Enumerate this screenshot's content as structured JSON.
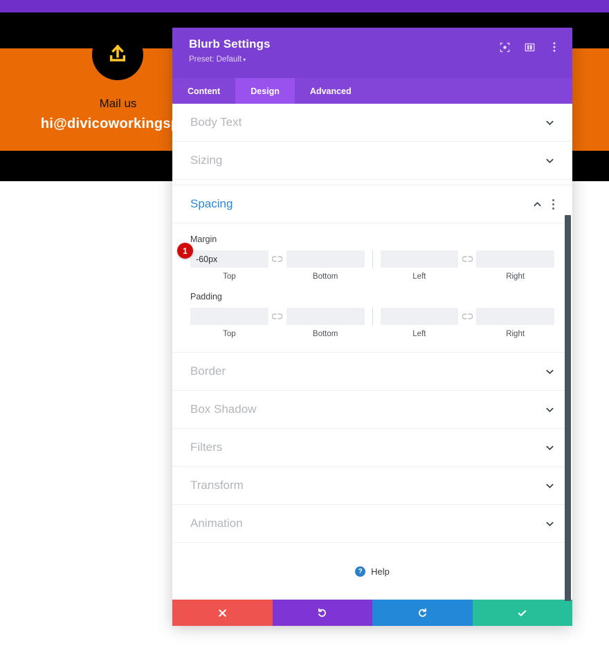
{
  "background": {
    "circle_icon": "upload-icon",
    "mail_label": "Mail us",
    "email": "hi@divicoworkingspac",
    "colors": {
      "top_bar": "#6f2fc8",
      "band": "#000000",
      "feature": "#ea6a06",
      "icon": "#ffc529"
    }
  },
  "modal": {
    "title": "Blurb Settings",
    "preset": "Preset: Default",
    "preset_caret": "▾",
    "header_icons": [
      {
        "name": "focus-icon"
      },
      {
        "name": "layout-icon"
      },
      {
        "name": "more-options-icon"
      }
    ],
    "tabs": [
      {
        "label": "Content",
        "active": false
      },
      {
        "label": "Design",
        "active": true
      },
      {
        "label": "Advanced",
        "active": false
      }
    ],
    "sections": [
      {
        "label": "Body Text",
        "state": "collapsed"
      },
      {
        "label": "Sizing",
        "state": "collapsed"
      },
      {
        "label": "Spacing",
        "state": "expanded"
      },
      {
        "label": "Border",
        "state": "collapsed"
      },
      {
        "label": "Box Shadow",
        "state": "collapsed"
      },
      {
        "label": "Filters",
        "state": "collapsed"
      },
      {
        "label": "Transform",
        "state": "collapsed"
      },
      {
        "label": "Animation",
        "state": "collapsed"
      }
    ],
    "spacing": {
      "margin": {
        "label": "Margin",
        "fields": [
          {
            "caption": "Top",
            "value": "-60px",
            "placeholder": ""
          },
          {
            "caption": "Bottom",
            "value": "",
            "placeholder": ""
          },
          {
            "caption": "Left",
            "value": "",
            "placeholder": ""
          },
          {
            "caption": "Right",
            "value": "",
            "placeholder": ""
          }
        ]
      },
      "padding": {
        "label": "Padding",
        "fields": [
          {
            "caption": "Top",
            "value": "",
            "placeholder": ""
          },
          {
            "caption": "Bottom",
            "value": "",
            "placeholder": ""
          },
          {
            "caption": "Left",
            "value": "",
            "placeholder": ""
          },
          {
            "caption": "Right",
            "value": "",
            "placeholder": ""
          }
        ]
      },
      "link_icon": "broken-link-icon"
    },
    "annotation_badge": "1",
    "help": {
      "label": "Help",
      "icon": "question-mark-icon"
    },
    "footer_buttons": [
      {
        "name": "close-button",
        "icon": "x-icon",
        "color": "#ef5350"
      },
      {
        "name": "undo-button",
        "icon": "undo-icon",
        "color": "#7f35d4"
      },
      {
        "name": "redo-button",
        "icon": "redo-icon",
        "color": "#2488d8"
      },
      {
        "name": "save-button",
        "icon": "check-icon",
        "color": "#27bf9a"
      }
    ]
  }
}
